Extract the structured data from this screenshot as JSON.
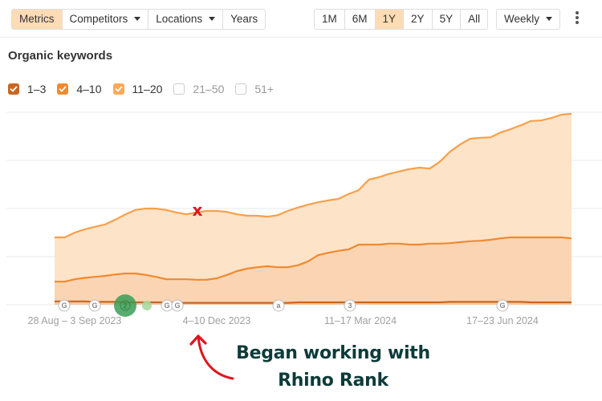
{
  "toolbar": {
    "view_tabs": [
      {
        "label": "Metrics",
        "active": true,
        "dropdown": false
      },
      {
        "label": "Competitors",
        "active": false,
        "dropdown": true
      },
      {
        "label": "Locations",
        "active": false,
        "dropdown": true
      },
      {
        "label": "Years",
        "active": false,
        "dropdown": false
      }
    ],
    "range_tabs": [
      {
        "label": "1M",
        "active": false
      },
      {
        "label": "6M",
        "active": false
      },
      {
        "label": "1Y",
        "active": true
      },
      {
        "label": "2Y",
        "active": false
      },
      {
        "label": "5Y",
        "active": false
      },
      {
        "label": "All",
        "active": false
      }
    ],
    "granularity": "Weekly",
    "more_icon": "vertical-ellipsis-icon"
  },
  "section_title": "Organic keywords",
  "legend": [
    {
      "label": "1–3",
      "checked": true,
      "color": "#c8671f"
    },
    {
      "label": "4–10",
      "checked": true,
      "color": "#f0892f"
    },
    {
      "label": "11–20",
      "checked": true,
      "color": "#fba95a"
    },
    {
      "label": "21–50",
      "checked": false,
      "color": "#cccccc"
    },
    {
      "label": "51+",
      "checked": false,
      "color": "#cccccc"
    }
  ],
  "annotation": {
    "line1": "Began working with",
    "line2": "Rhino Rank",
    "arrow_color": "#e0141e",
    "text_color": "#0d3b3a",
    "x_mark": "x"
  },
  "chart_data": {
    "type": "area",
    "title": "Organic keywords",
    "xlabel": "",
    "ylabel": "",
    "y_units": "relative (gridline units, no tick labels shown)",
    "ylim": [
      0,
      4
    ],
    "grid": true,
    "stacked": true,
    "x_tick_labels": [
      "28 Aug – 3 Sep 2023",
      "4–10 Dec 2023",
      "11–17 Mar 2024",
      "17–23 Jun 2024"
    ],
    "x_tick_index": [
      2,
      16,
      30,
      44
    ],
    "n_points": 52,
    "series": [
      {
        "name": "11–20",
        "cumulative": true,
        "color": "#f7a04b",
        "fill": "#fde3c8",
        "values": [
          1.4,
          1.4,
          1.5,
          1.57,
          1.62,
          1.67,
          1.77,
          1.88,
          1.97,
          2.0,
          2.0,
          1.97,
          1.92,
          1.88,
          1.92,
          1.95,
          1.95,
          1.93,
          1.88,
          1.85,
          1.85,
          1.83,
          1.86,
          1.95,
          2.02,
          2.08,
          2.13,
          2.17,
          2.2,
          2.3,
          2.38,
          2.6,
          2.65,
          2.72,
          2.77,
          2.82,
          2.85,
          2.83,
          2.97,
          3.18,
          3.33,
          3.45,
          3.47,
          3.48,
          3.58,
          3.65,
          3.73,
          3.82,
          3.83,
          3.88,
          3.95,
          3.97
        ]
      },
      {
        "name": "4–10",
        "cumulative": true,
        "color": "#f0892f",
        "fill": "#fbd5b3",
        "values": [
          0.48,
          0.48,
          0.53,
          0.56,
          0.58,
          0.6,
          0.63,
          0.65,
          0.65,
          0.62,
          0.58,
          0.53,
          0.53,
          0.53,
          0.52,
          0.52,
          0.55,
          0.62,
          0.7,
          0.75,
          0.78,
          0.8,
          0.78,
          0.78,
          0.82,
          0.9,
          1.03,
          1.08,
          1.12,
          1.15,
          1.25,
          1.25,
          1.25,
          1.27,
          1.27,
          1.25,
          1.25,
          1.27,
          1.27,
          1.28,
          1.3,
          1.32,
          1.33,
          1.35,
          1.38,
          1.4,
          1.4,
          1.4,
          1.4,
          1.4,
          1.4,
          1.38
        ]
      },
      {
        "name": "1–3",
        "cumulative": true,
        "color": "#c8671f",
        "fill": "#f6c9a3",
        "values": [
          0.07,
          0.07,
          0.07,
          0.07,
          0.06,
          0.06,
          0.06,
          0.05,
          0.05,
          0.05,
          0.05,
          0.05,
          0.04,
          0.04,
          0.04,
          0.04,
          0.04,
          0.04,
          0.04,
          0.04,
          0.04,
          0.04,
          0.04,
          0.04,
          0.05,
          0.05,
          0.05,
          0.05,
          0.05,
          0.05,
          0.05,
          0.05,
          0.05,
          0.05,
          0.05,
          0.05,
          0.05,
          0.05,
          0.05,
          0.06,
          0.06,
          0.06,
          0.06,
          0.06,
          0.06,
          0.06,
          0.06,
          0.05,
          0.05,
          0.05,
          0.05,
          0.05
        ]
      }
    ],
    "event_markers": [
      {
        "index": 1,
        "label": "G",
        "kind": "google-update"
      },
      {
        "index": 5,
        "label": "G",
        "kind": "google-update"
      },
      {
        "index": 8,
        "label": "2",
        "kind": "cluster",
        "color": "#3b9d57",
        "highlight": true
      },
      {
        "index": 10,
        "label": "",
        "kind": "cluster",
        "color": "#a7d8a0"
      },
      {
        "index": 13,
        "label": "G",
        "kind": "google-update"
      },
      {
        "index": 14,
        "label": "G",
        "kind": "google-update"
      },
      {
        "index": 26,
        "label": "a",
        "kind": "annotation"
      },
      {
        "index": 34,
        "label": "3",
        "kind": "cluster"
      },
      {
        "index": 51,
        "label": "G",
        "kind": "google-update",
        "at_x": 626
      }
    ],
    "annotation_mark_index": 16
  }
}
